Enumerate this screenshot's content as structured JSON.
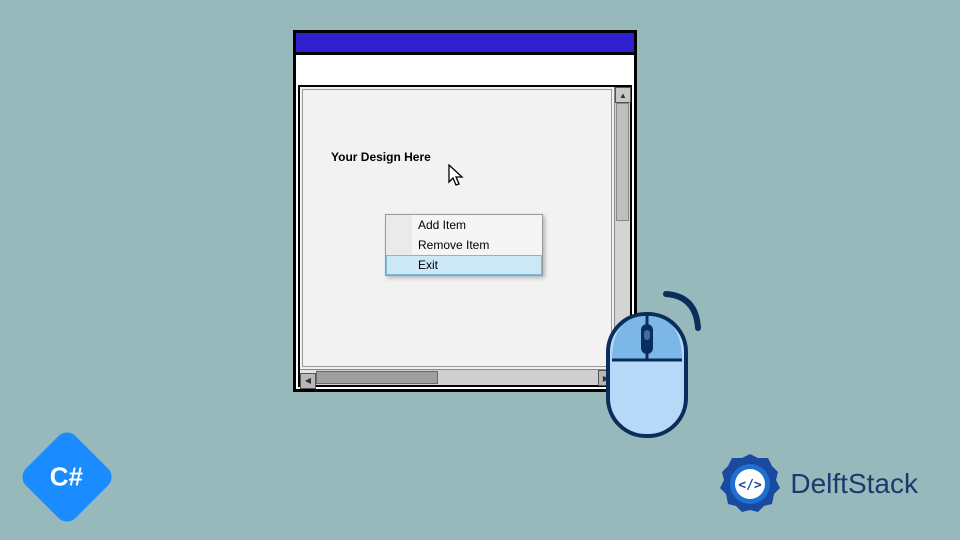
{
  "window": {
    "design_label": "Your Design Here",
    "context_menu": {
      "items": [
        {
          "label": "Add Item",
          "highlighted": false
        },
        {
          "label": "Remove Item",
          "highlighted": false
        },
        {
          "label": "Exit",
          "highlighted": true
        }
      ]
    }
  },
  "badges": {
    "csharp": "C#",
    "delftstack": "DelftStack"
  }
}
